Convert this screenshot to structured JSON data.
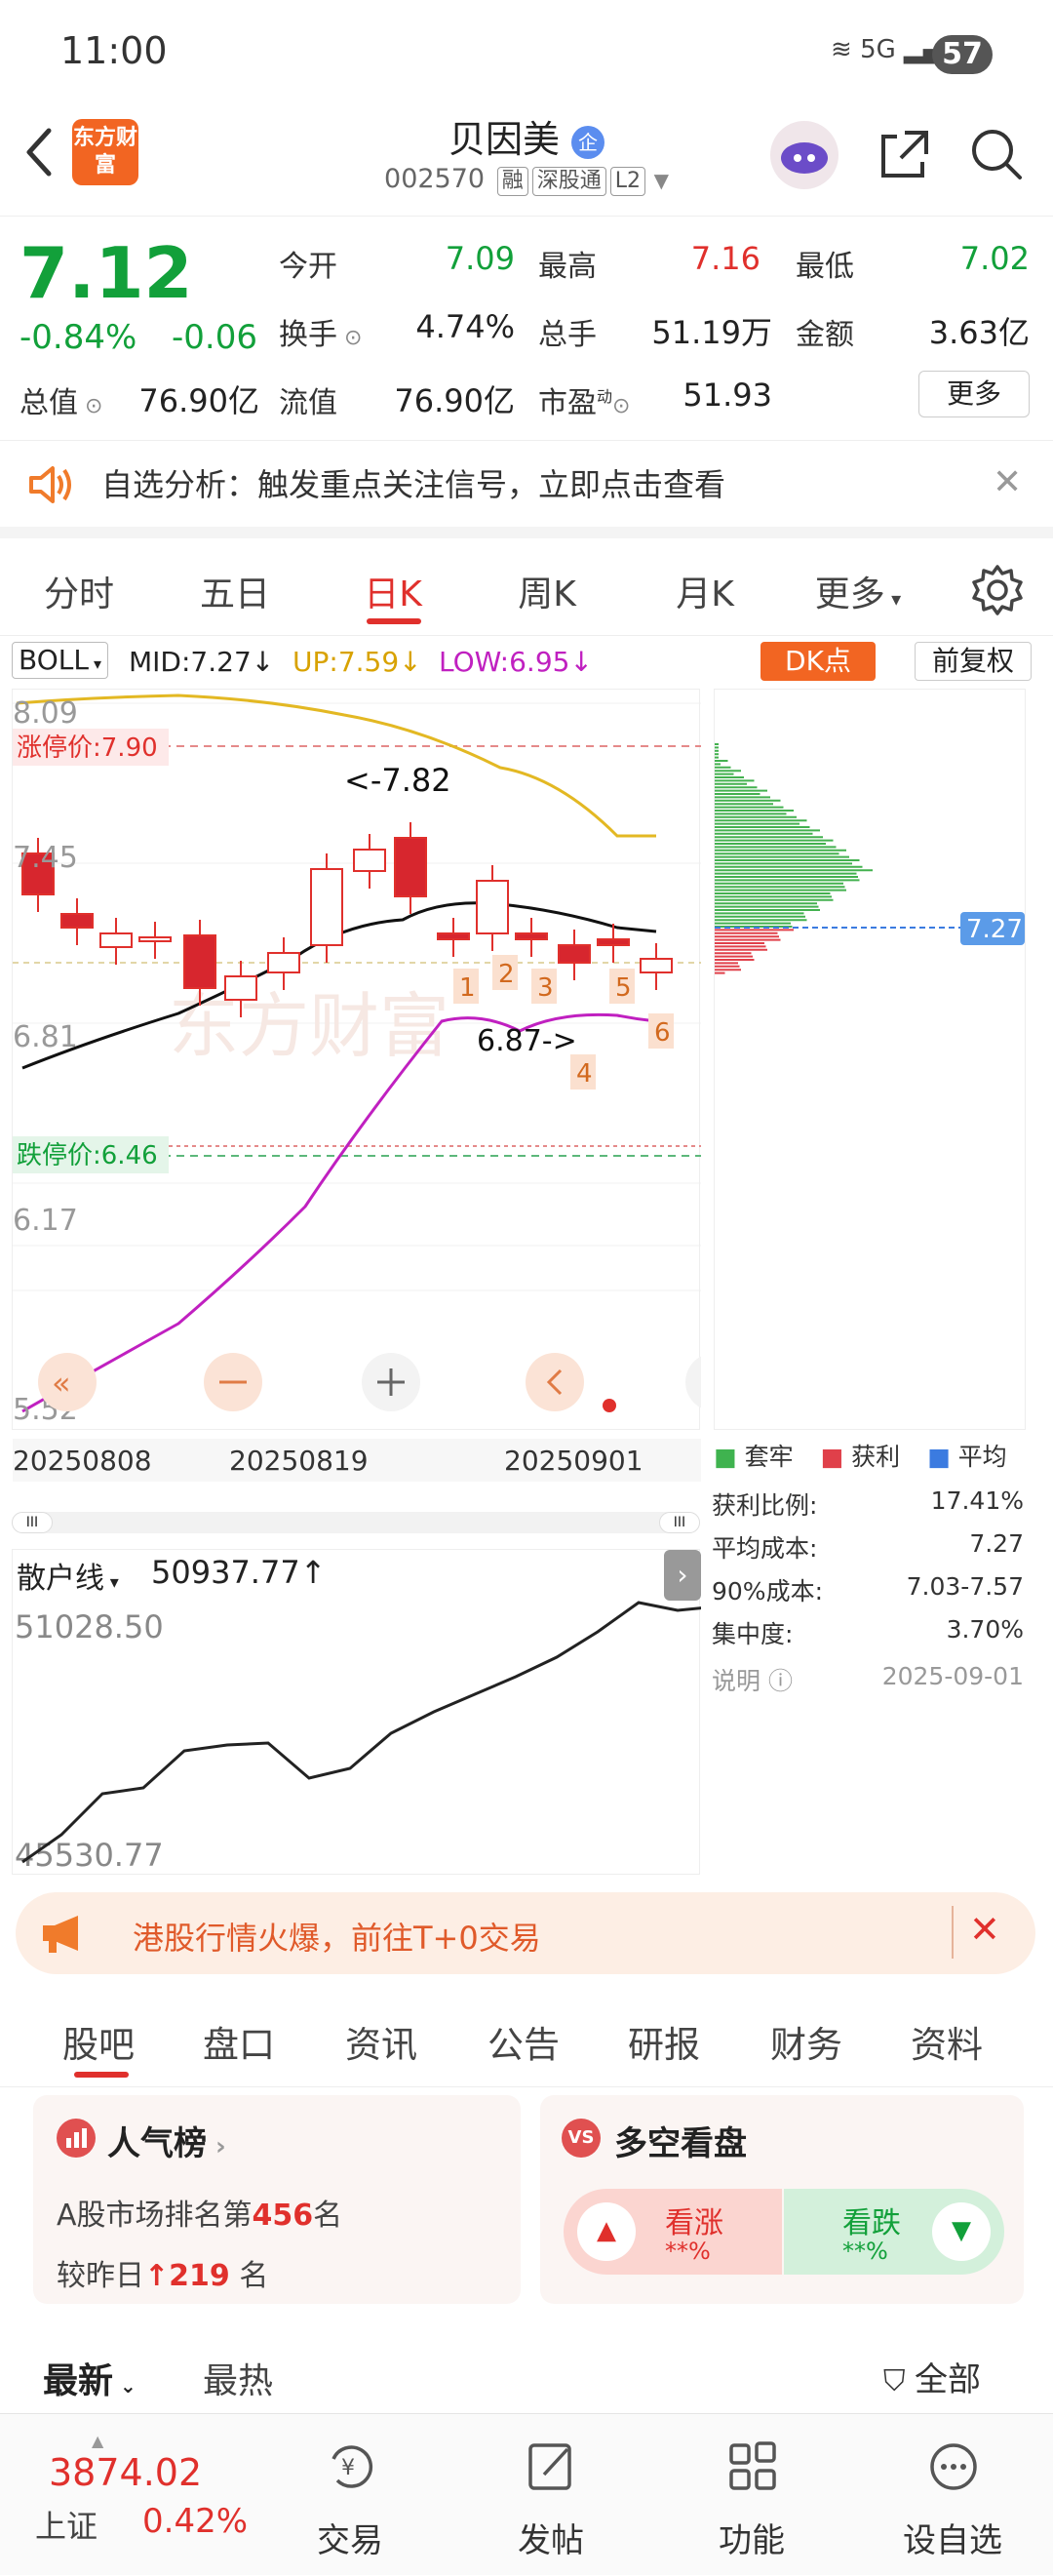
{
  "status": {
    "time": "11:00",
    "battery": "57",
    "signal": "5G"
  },
  "header": {
    "name": "贝因美",
    "code": "002570",
    "tags": [
      "融",
      "深股通",
      "L2"
    ],
    "logo": "东方财富",
    "badge": "企"
  },
  "quote": {
    "price": "7.12",
    "pct": "-0.84%",
    "chg": "-0.06",
    "open_l": "今开",
    "open": "7.09",
    "high_l": "最高",
    "high": "7.16",
    "low_l": "最低",
    "low": "7.02",
    "turn_l": "换手",
    "turn": "4.74%",
    "vol_l": "总手",
    "vol": "51.19万",
    "amt_l": "金额",
    "amt": "3.63亿",
    "mcap_l": "总值",
    "mcap": "76.90亿",
    "float_l": "流值",
    "float": "76.90亿",
    "pe_l": "市盈",
    "pe_sup": "动",
    "pe": "51.93",
    "more": "更多"
  },
  "notice": {
    "text": "自选分析：触发重点关注信号，立即点击查看"
  },
  "tabs": [
    "分时",
    "五日",
    "日K",
    "周K",
    "月K",
    "更多"
  ],
  "indicator": {
    "name": "BOLL",
    "mid": "MID:7.27",
    "up": "UP:7.59",
    "low": "LOW:6.95",
    "dk": "DK点",
    "adj": "前复权"
  },
  "kchart": {
    "yticks": [
      "8.09",
      "7.45",
      "6.81",
      "6.17",
      "5.52"
    ],
    "limit_up": "涨停价:7.90",
    "limit_down": "跌停价:6.46",
    "annot_high": "<-7.82",
    "annot_low": "6.87->",
    "markers": [
      "1",
      "2",
      "3",
      "4",
      "5",
      "6"
    ],
    "dates": [
      "20250808",
      "20250819",
      "20250901"
    ],
    "watermark": "东方财富"
  },
  "chip": {
    "avg_label": "7.27",
    "legend": [
      "套牢",
      "获利",
      "平均"
    ],
    "stats": [
      {
        "l": "获利比例:",
        "v": "17.41%"
      },
      {
        "l": "平均成本:",
        "v": "7.27"
      },
      {
        "l": "90%成本:",
        "v": "7.03-7.57"
      },
      {
        "l": "集中度:",
        "v": "3.70%"
      }
    ],
    "desc": "说明",
    "date": "2025-09-01"
  },
  "vol": {
    "name": "散户线",
    "value": "50937.77↑",
    "top": "51028.50",
    "bottom": "45530.77"
  },
  "promo": {
    "text": "港股行情火爆，前往T+0交易"
  },
  "subtabs": [
    "股吧",
    "盘口",
    "资讯",
    "公告",
    "研报",
    "财务",
    "资料"
  ],
  "cards": {
    "pop_title": "人气榜",
    "pop_rank_pre": "A股市场排名第",
    "pop_rank": "456",
    "pop_rank_post": "名",
    "pop_prev_pre": "较昨日",
    "pop_prev": "219",
    "pop_prev_post": "名",
    "ls_title": "多空看盘",
    "bull": "看涨",
    "bull_v": "**%",
    "bear": "看跌",
    "bear_v": "**%"
  },
  "feed": {
    "latest": "最新",
    "hot": "最热",
    "all": "全部"
  },
  "bottom": {
    "index_val": "3874.02",
    "index_name": "上证",
    "index_pct": "0.42%",
    "items": [
      "交易",
      "发帖",
      "功能",
      "设自选"
    ]
  }
}
